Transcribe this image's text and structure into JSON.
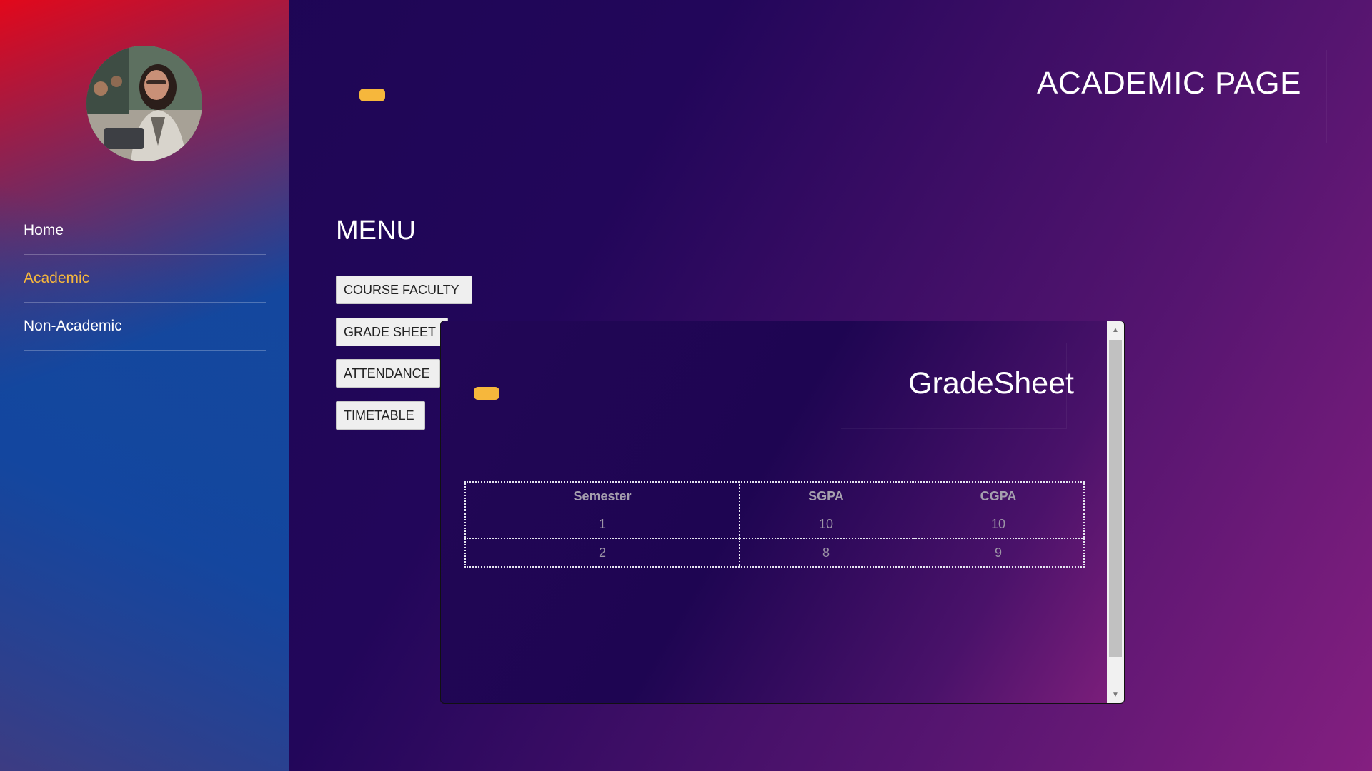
{
  "sidebar": {
    "items": [
      {
        "label": "Home",
        "active": false
      },
      {
        "label": "Academic",
        "active": true
      },
      {
        "label": "Non-Academic",
        "active": false
      }
    ]
  },
  "header": {
    "title": "ACADEMIC PAGE"
  },
  "menu": {
    "title": "MENU",
    "buttons": {
      "course_faculty": "COURSE FACULTY",
      "grade_sheet": "GRADE SHEET",
      "attendance": "ATTENDANCE",
      "timetable": "TIMETABLE"
    }
  },
  "popup": {
    "title": "GradeSheet",
    "table": {
      "headers": [
        "Semester",
        "SGPA",
        "CGPA"
      ],
      "rows": [
        [
          "1",
          "10",
          "10"
        ],
        [
          "2",
          "8",
          "9"
        ]
      ]
    }
  },
  "colors": {
    "accent": "#f6b73c",
    "sidebar_top": "#e2081b",
    "sidebar_bottom": "#1246a0",
    "background_dark": "#1c0552",
    "background_light": "#841f80"
  },
  "icons": {
    "scroll_up": "scroll-up-arrow-icon",
    "scroll_down": "scroll-down-arrow-icon"
  }
}
